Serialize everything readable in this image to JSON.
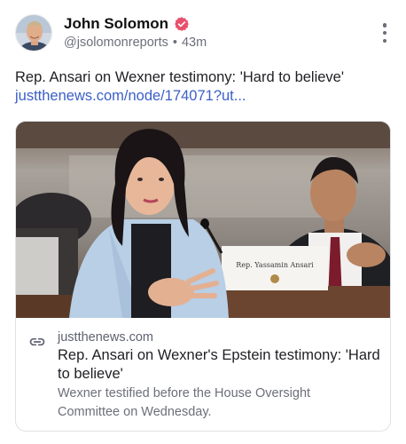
{
  "author": {
    "display_name": "John Solomon",
    "handle": "@jsolomonreports",
    "separator": "•",
    "timestamp": "43m",
    "verified_badge": "verified-icon",
    "avatar": "avatar-photo"
  },
  "post": {
    "text": "Rep. Ansari on Wexner testimony: 'Hard to believe'",
    "link_text": "justthenews.com/node/174071?ut..."
  },
  "link_card": {
    "domain": "justthenews.com",
    "title": "Rep. Ansari on Wexner's Epstein testimony: 'Hard to believe'",
    "description": "Wexner testified before the House Oversight Committee on Wednesday.",
    "nameplate_text": "Rep. Yassamin Ansari",
    "link_icon": "link-icon"
  },
  "menu": {
    "icon": "more-vertical-icon"
  },
  "colors": {
    "link": "#3a5fc8",
    "verified": "#e8506c",
    "muted": "#6c6f7a",
    "text": "#1f1f24"
  }
}
